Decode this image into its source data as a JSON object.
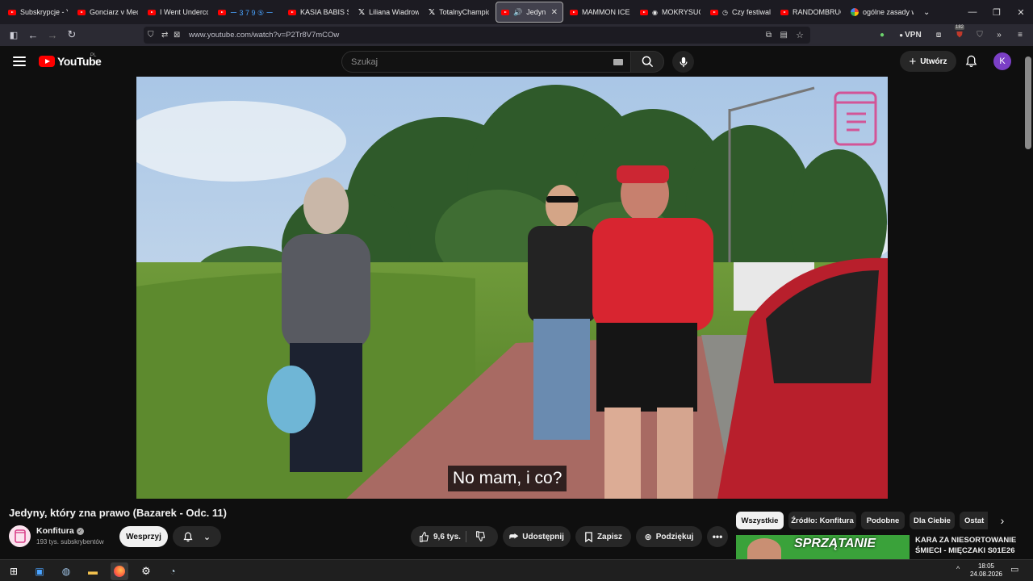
{
  "browser": {
    "tabs": [
      {
        "label": "Subskrypcje - Yo",
        "icon": "youtube-icon"
      },
      {
        "label": "Gonciarz v Meci",
        "icon": "youtube-icon"
      },
      {
        "label": "I Went Undercov",
        "icon": "youtube-icon"
      },
      {
        "label": "ー 3 7 9 ⑤ ー",
        "icon": "youtube-icon"
      },
      {
        "label": "KASIA BABIS SZC",
        "icon": "youtube-icon"
      },
      {
        "label": "Liliana Wiadrow",
        "icon": "x-icon"
      },
      {
        "label": "TotalnyChampic",
        "icon": "x-icon"
      },
      {
        "label": "Jedyny, kt",
        "icon": "youtube-icon",
        "active": true
      },
      {
        "label": "MAMMON ICEBI",
        "icon": "youtube-icon"
      },
      {
        "label": "MOKRYSUCI",
        "icon": "youtube-icon"
      },
      {
        "label": "Czy festiwal",
        "icon": "youtube-icon"
      },
      {
        "label": "RANDOMBRUCE",
        "icon": "youtube-icon"
      },
      {
        "label": "ogólne zasady w",
        "icon": "google-icon"
      }
    ],
    "url": "www.youtube.com/watch?v=P2Tr8V7mCOw",
    "vpn_label": "VPN",
    "badge_count": "182"
  },
  "header": {
    "logo_text": "YouTube",
    "region": "PL",
    "search_placeholder": "Szukaj",
    "create_label": "Utwórz",
    "avatar_letter": "K"
  },
  "video": {
    "subtitle": "No mam, i co?",
    "title": "Jedyny, który zna prawo (Bazarek - Odc. 11)"
  },
  "channel": {
    "name": "Konfitura",
    "subscribers": "193 tys. subskrybentów",
    "support_label": "Wesprzyj"
  },
  "actions": {
    "likes": "9,6 tys.",
    "share_label": "Udostępnij",
    "save_label": "Zapisz",
    "thanks_label": "Podziękuj"
  },
  "chips": [
    "Wszystkie",
    "Źródło: Konfitura",
    "Podobne",
    "Dla Ciebie",
    "Ostat"
  ],
  "recommendation": {
    "thumb_text": "SPRZĄTANIE",
    "title": "KARA ZA NIESORTOWANIE ŚMIECI - MIĘCZAKI S01E26"
  },
  "taskbar": {
    "time": "18:05",
    "date": "24.08.2026"
  }
}
